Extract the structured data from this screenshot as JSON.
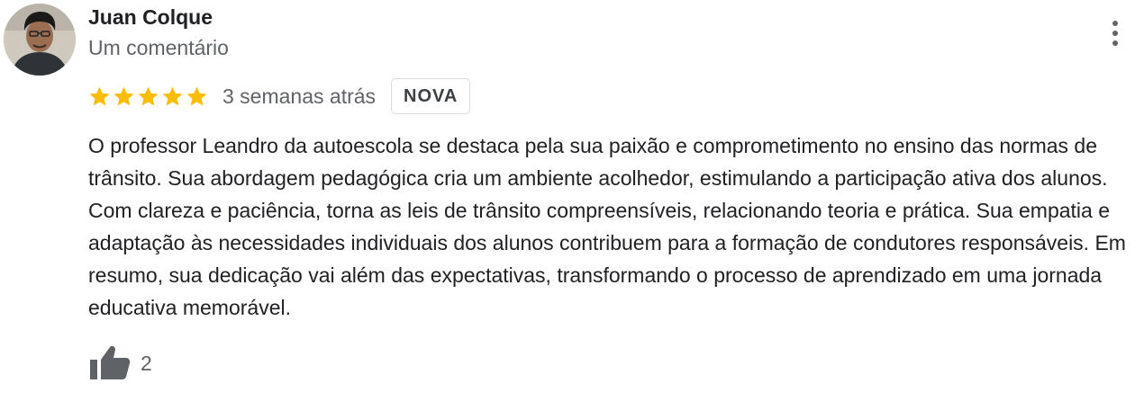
{
  "review": {
    "author_name": "Juan Colque",
    "author_subtitle": "Um comentário",
    "rating": 5,
    "rating_max": 5,
    "star_color": "#fbbc04",
    "date": "3 semanas atrás",
    "badge": "NOVA",
    "text": "O professor Leandro da autoescola se destaca pela sua paixão e comprometimento no ensino das normas de trânsito. Sua abordagem pedagógica cria um ambiente acolhedor, estimulando a participação ativa dos alunos. Com clareza e paciência, torna as leis de trânsito compreensíveis, relacionando teoria e prática. Sua empatia e adaptação às necessidades individuais dos alunos contribuem para a formação de condutores responsáveis. Em resumo, sua dedicação vai além das expectativas, transformando o processo de aprendizado em uma jornada educativa memorável.",
    "like_count": "2"
  },
  "icons": {
    "more": "more-vert-icon",
    "like": "thumb-up-icon",
    "star": "star-icon"
  }
}
